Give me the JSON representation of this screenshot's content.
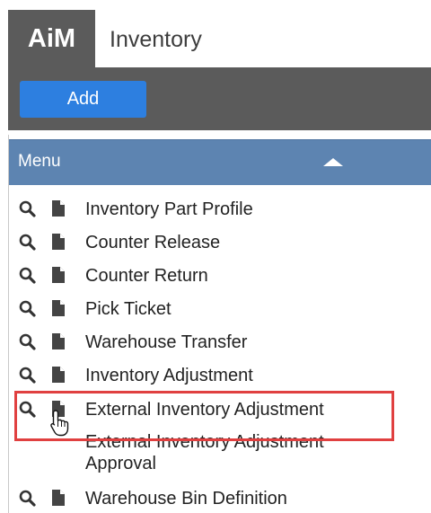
{
  "app": {
    "logo": "AiM",
    "title": "Inventory"
  },
  "toolbar": {
    "add_label": "Add"
  },
  "menu": {
    "title": "Menu",
    "items": [
      {
        "label": "Inventory Part Profile"
      },
      {
        "label": "Counter Release"
      },
      {
        "label": "Counter Return"
      },
      {
        "label": "Pick Ticket"
      },
      {
        "label": "Warehouse Transfer"
      },
      {
        "label": "Inventory Adjustment"
      },
      {
        "label": "External Inventory Adjustment"
      },
      {
        "label": "External Inventory Adjustment Approval"
      },
      {
        "label": "Warehouse Bin Definition"
      }
    ]
  },
  "colors": {
    "toolbar": "#5b5b5b",
    "accent": "#2d7fe0",
    "menu_header": "#5d84b1",
    "highlight": "#e04040"
  }
}
